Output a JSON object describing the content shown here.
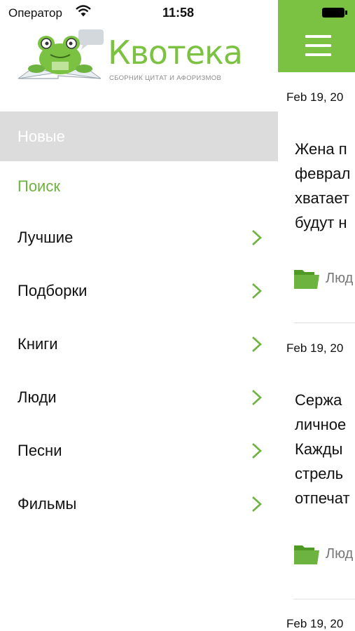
{
  "status_bar": {
    "carrier": "Оператор",
    "time": "11:58"
  },
  "logo": {
    "title": "Квотека",
    "subtitle": "СБОРНИК ЦИТАТ И АФОРИЗМОВ"
  },
  "menu": {
    "items": [
      {
        "label": "Новые",
        "state": "selected"
      },
      {
        "label": "Поиск",
        "state": "highlighted"
      },
      {
        "label": "Лучшие",
        "has_chevron": true
      },
      {
        "label": "Подборки",
        "has_chevron": true
      },
      {
        "label": "Книги",
        "has_chevron": true
      },
      {
        "label": "Люди",
        "has_chevron": true
      },
      {
        "label": "Песни",
        "has_chevron": true
      },
      {
        "label": "Фильмы",
        "has_chevron": true
      }
    ]
  },
  "content": {
    "posts": [
      {
        "date": "Feb 19, 20",
        "lines": [
          "Жена п",
          "феврал",
          "хватает",
          "будут н"
        ],
        "category": "Люд"
      },
      {
        "date": "Feb 19, 20",
        "lines": [
          "Сержа",
          "личное",
          "Кажды",
          "стрель",
          "отпечат"
        ],
        "category": "Люд"
      },
      {
        "date": "Feb 19, 20"
      }
    ]
  },
  "colors": {
    "accent": "#7cc242",
    "search_text": "#6cb33f",
    "selected_bg": "#dcdcdc"
  }
}
